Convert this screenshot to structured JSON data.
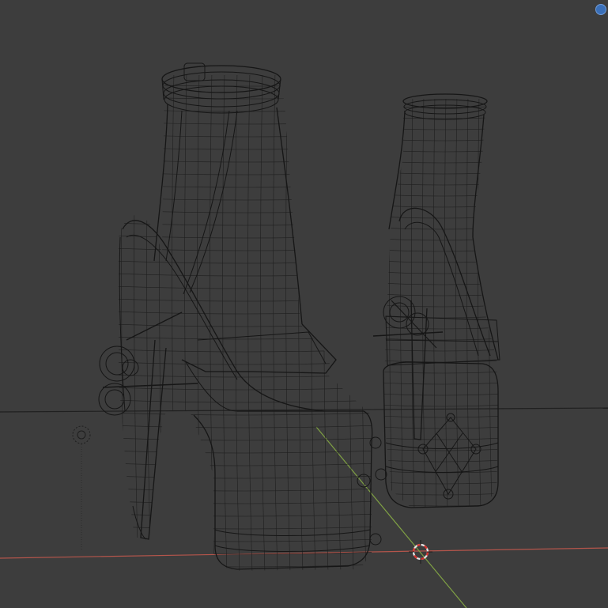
{
  "app": {
    "view": "3d-viewport",
    "shading_mode": "wireframe"
  },
  "colors": {
    "background": "#3d3d3d",
    "wire": "#161616",
    "horizon_line": "#202020",
    "x_axis": "#b4554b",
    "y_axis": "#7fa044",
    "cursor_red": "#d8312c",
    "cursor_white": "#e6e6e6",
    "gizmo_blue": "#3a6fb8"
  },
  "scene": {
    "objects": [
      {
        "name": "boot-left",
        "type": "mesh"
      },
      {
        "name": "boot-right",
        "type": "mesh"
      },
      {
        "name": "light",
        "type": "light"
      }
    ],
    "axes": [
      "x",
      "y"
    ]
  },
  "icons": {
    "gizmo": "view-gizmo-icon",
    "cursor": "3d-cursor-icon",
    "light": "light-icon"
  }
}
